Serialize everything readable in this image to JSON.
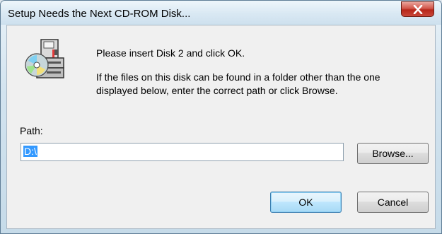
{
  "window": {
    "title": "Setup Needs the Next CD-ROM Disk...",
    "close_icon": "close-icon"
  },
  "dialog": {
    "icon": "cd-rom-drive-icon",
    "message_line1": "Please insert Disk 2 and click OK.",
    "message_line2": "If the files on this disk can be found in a folder other than the one displayed below, enter the correct path or click Browse.",
    "path_label": "Path:",
    "path_value": "D:\\",
    "browse_label": "Browse...",
    "ok_label": "OK",
    "cancel_label": "Cancel"
  }
}
